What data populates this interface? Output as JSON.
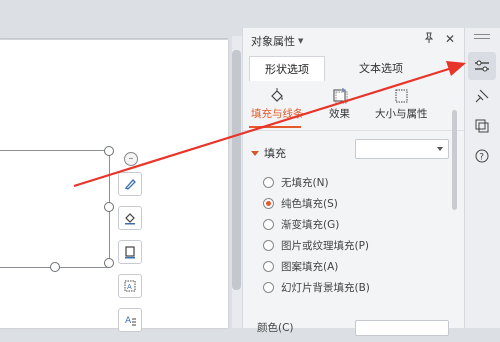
{
  "panel": {
    "title": "对象属性",
    "tabs": [
      {
        "label": "形状选项",
        "active": true
      },
      {
        "label": "文本选项",
        "active": false
      }
    ],
    "subtabs": [
      {
        "label": "填充与线条",
        "active": true,
        "icon": "fill-bucket-icon"
      },
      {
        "label": "效果",
        "active": false,
        "icon": "effects-icon"
      },
      {
        "label": "大小与属性",
        "active": false,
        "icon": "size-properties-icon"
      }
    ],
    "section": {
      "title": "填充",
      "dropdown_value": ""
    },
    "fill_options": [
      {
        "label": "无填充(N)",
        "checked": false
      },
      {
        "label": "纯色填充(S)",
        "checked": true
      },
      {
        "label": "渐变填充(G)",
        "checked": false
      },
      {
        "label": "图片或纹理填充(P)",
        "checked": false
      },
      {
        "label": "图案填充(A)",
        "checked": false
      },
      {
        "label": "幻灯片背景填充(B)",
        "checked": false
      }
    ],
    "bottom_field_label": "颜色(C)"
  },
  "rail": {
    "buttons": [
      {
        "name": "property-settings-icon",
        "active": true
      },
      {
        "name": "pin-icon",
        "active": false
      },
      {
        "name": "transition-icon",
        "active": false
      },
      {
        "name": "help-icon",
        "active": false
      }
    ]
  },
  "floating_toolbar": [
    "shape-style-icon",
    "fill-icon",
    "outline-icon",
    "text-wrap-icon",
    "text-style-icon"
  ],
  "colors": {
    "accent": "#e45a2a",
    "annotation_arrow": "#e8352a"
  }
}
